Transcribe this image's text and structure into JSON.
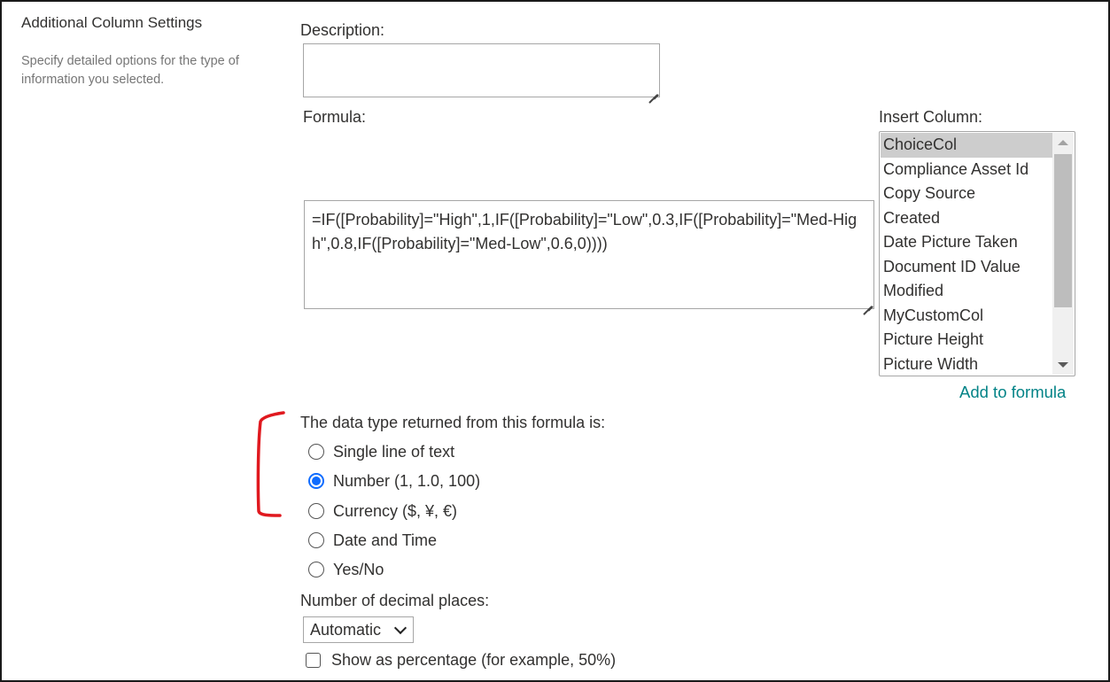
{
  "section": {
    "title": "Additional Column Settings",
    "description": "Specify detailed options for the type of information you selected."
  },
  "description_field": {
    "label": "Description:",
    "value": ""
  },
  "formula_field": {
    "label": "Formula:",
    "value": "=IF([Probability]=\"High\",1,IF([Probability]=\"Low\",0.3,IF([Probability]=\"Med-High\",0.8,IF([Probability]=\"Med-Low\",0.6,0))))"
  },
  "insert_column": {
    "label": "Insert Column:",
    "items": [
      "ChoiceCol",
      "Compliance Asset Id",
      "Copy Source",
      "Created",
      "Date Picture Taken",
      "Document ID Value",
      "Modified",
      "MyCustomCol",
      "Picture Height",
      "Picture Width"
    ],
    "selected": "ChoiceCol",
    "add_link": "Add to formula"
  },
  "data_type": {
    "label": "The data type returned from this formula is:",
    "options": [
      "Single line of text",
      "Number (1, 1.0, 100)",
      "Currency ($, ¥, €)",
      "Date and Time",
      "Yes/No"
    ],
    "selected": "Number (1, 1.0, 100)"
  },
  "decimal_places": {
    "label": "Number of decimal places:",
    "value": "Automatic"
  },
  "percentage": {
    "label": "Show as percentage (for example, 50%)",
    "checked": false
  },
  "colors": {
    "accent_link": "#038387",
    "radio_selected": "#0f6cff",
    "annotation": "#e0191f",
    "list_selected_bg": "#cdcdcd"
  }
}
